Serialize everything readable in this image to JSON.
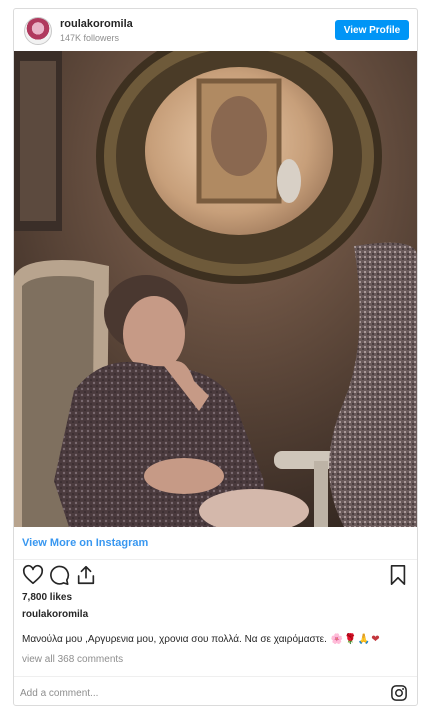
{
  "header": {
    "username": "roulakoromila",
    "followers": "147K followers",
    "view_profile_label": "View Profile"
  },
  "post": {
    "image_alt": "Elderly woman seated in an armchair beneath an ornate round mirror",
    "view_more_label": "View More on Instagram",
    "likes": "7,800 likes",
    "poster": "roulakoromila",
    "caption": "Μανούλα μου ,Αργυρενια μου, χρονια σου πολλά. Να σε χαιρόμαστε.",
    "caption_emojis": "🌸🌹🙏❤",
    "comments_link": "view all 368 comments"
  },
  "comment": {
    "placeholder": "Add a comment..."
  },
  "icons": {
    "like": "heart-icon",
    "comment": "comment-icon",
    "share": "share-icon",
    "save": "bookmark-icon",
    "instagram": "instagram-icon"
  },
  "colors": {
    "accent": "#0095f6",
    "link": "#3897f0",
    "muted": "#8e8e8e"
  }
}
